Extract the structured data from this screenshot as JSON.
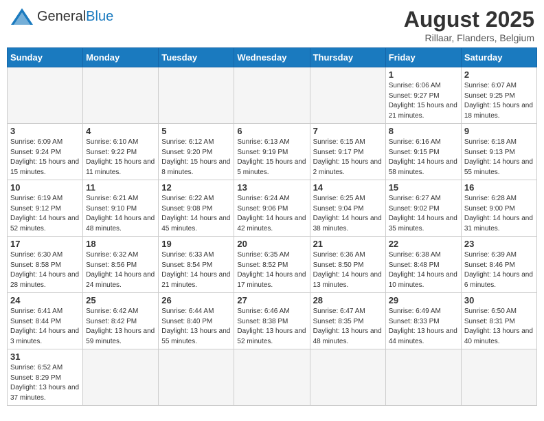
{
  "header": {
    "logo_general": "General",
    "logo_blue": "Blue",
    "month_title": "August 2025",
    "location": "Rillaar, Flanders, Belgium"
  },
  "days_of_week": [
    "Sunday",
    "Monday",
    "Tuesday",
    "Wednesday",
    "Thursday",
    "Friday",
    "Saturday"
  ],
  "weeks": [
    [
      {
        "day": "",
        "info": "",
        "empty": true
      },
      {
        "day": "",
        "info": "",
        "empty": true
      },
      {
        "day": "",
        "info": "",
        "empty": true
      },
      {
        "day": "",
        "info": "",
        "empty": true
      },
      {
        "day": "",
        "info": "",
        "empty": true
      },
      {
        "day": "1",
        "info": "Sunrise: 6:06 AM\nSunset: 9:27 PM\nDaylight: 15 hours and 21 minutes."
      },
      {
        "day": "2",
        "info": "Sunrise: 6:07 AM\nSunset: 9:25 PM\nDaylight: 15 hours and 18 minutes."
      }
    ],
    [
      {
        "day": "3",
        "info": "Sunrise: 6:09 AM\nSunset: 9:24 PM\nDaylight: 15 hours and 15 minutes."
      },
      {
        "day": "4",
        "info": "Sunrise: 6:10 AM\nSunset: 9:22 PM\nDaylight: 15 hours and 11 minutes."
      },
      {
        "day": "5",
        "info": "Sunrise: 6:12 AM\nSunset: 9:20 PM\nDaylight: 15 hours and 8 minutes."
      },
      {
        "day": "6",
        "info": "Sunrise: 6:13 AM\nSunset: 9:19 PM\nDaylight: 15 hours and 5 minutes."
      },
      {
        "day": "7",
        "info": "Sunrise: 6:15 AM\nSunset: 9:17 PM\nDaylight: 15 hours and 2 minutes."
      },
      {
        "day": "8",
        "info": "Sunrise: 6:16 AM\nSunset: 9:15 PM\nDaylight: 14 hours and 58 minutes."
      },
      {
        "day": "9",
        "info": "Sunrise: 6:18 AM\nSunset: 9:13 PM\nDaylight: 14 hours and 55 minutes."
      }
    ],
    [
      {
        "day": "10",
        "info": "Sunrise: 6:19 AM\nSunset: 9:12 PM\nDaylight: 14 hours and 52 minutes."
      },
      {
        "day": "11",
        "info": "Sunrise: 6:21 AM\nSunset: 9:10 PM\nDaylight: 14 hours and 48 minutes."
      },
      {
        "day": "12",
        "info": "Sunrise: 6:22 AM\nSunset: 9:08 PM\nDaylight: 14 hours and 45 minutes."
      },
      {
        "day": "13",
        "info": "Sunrise: 6:24 AM\nSunset: 9:06 PM\nDaylight: 14 hours and 42 minutes."
      },
      {
        "day": "14",
        "info": "Sunrise: 6:25 AM\nSunset: 9:04 PM\nDaylight: 14 hours and 38 minutes."
      },
      {
        "day": "15",
        "info": "Sunrise: 6:27 AM\nSunset: 9:02 PM\nDaylight: 14 hours and 35 minutes."
      },
      {
        "day": "16",
        "info": "Sunrise: 6:28 AM\nSunset: 9:00 PM\nDaylight: 14 hours and 31 minutes."
      }
    ],
    [
      {
        "day": "17",
        "info": "Sunrise: 6:30 AM\nSunset: 8:58 PM\nDaylight: 14 hours and 28 minutes."
      },
      {
        "day": "18",
        "info": "Sunrise: 6:32 AM\nSunset: 8:56 PM\nDaylight: 14 hours and 24 minutes."
      },
      {
        "day": "19",
        "info": "Sunrise: 6:33 AM\nSunset: 8:54 PM\nDaylight: 14 hours and 21 minutes."
      },
      {
        "day": "20",
        "info": "Sunrise: 6:35 AM\nSunset: 8:52 PM\nDaylight: 14 hours and 17 minutes."
      },
      {
        "day": "21",
        "info": "Sunrise: 6:36 AM\nSunset: 8:50 PM\nDaylight: 14 hours and 13 minutes."
      },
      {
        "day": "22",
        "info": "Sunrise: 6:38 AM\nSunset: 8:48 PM\nDaylight: 14 hours and 10 minutes."
      },
      {
        "day": "23",
        "info": "Sunrise: 6:39 AM\nSunset: 8:46 PM\nDaylight: 14 hours and 6 minutes."
      }
    ],
    [
      {
        "day": "24",
        "info": "Sunrise: 6:41 AM\nSunset: 8:44 PM\nDaylight: 14 hours and 3 minutes."
      },
      {
        "day": "25",
        "info": "Sunrise: 6:42 AM\nSunset: 8:42 PM\nDaylight: 13 hours and 59 minutes."
      },
      {
        "day": "26",
        "info": "Sunrise: 6:44 AM\nSunset: 8:40 PM\nDaylight: 13 hours and 55 minutes."
      },
      {
        "day": "27",
        "info": "Sunrise: 6:46 AM\nSunset: 8:38 PM\nDaylight: 13 hours and 52 minutes."
      },
      {
        "day": "28",
        "info": "Sunrise: 6:47 AM\nSunset: 8:35 PM\nDaylight: 13 hours and 48 minutes."
      },
      {
        "day": "29",
        "info": "Sunrise: 6:49 AM\nSunset: 8:33 PM\nDaylight: 13 hours and 44 minutes."
      },
      {
        "day": "30",
        "info": "Sunrise: 6:50 AM\nSunset: 8:31 PM\nDaylight: 13 hours and 40 minutes."
      }
    ],
    [
      {
        "day": "31",
        "info": "Sunrise: 6:52 AM\nSunset: 8:29 PM\nDaylight: 13 hours and 37 minutes."
      },
      {
        "day": "",
        "info": "",
        "empty": true
      },
      {
        "day": "",
        "info": "",
        "empty": true
      },
      {
        "day": "",
        "info": "",
        "empty": true
      },
      {
        "day": "",
        "info": "",
        "empty": true
      },
      {
        "day": "",
        "info": "",
        "empty": true
      },
      {
        "day": "",
        "info": "",
        "empty": true
      }
    ]
  ]
}
